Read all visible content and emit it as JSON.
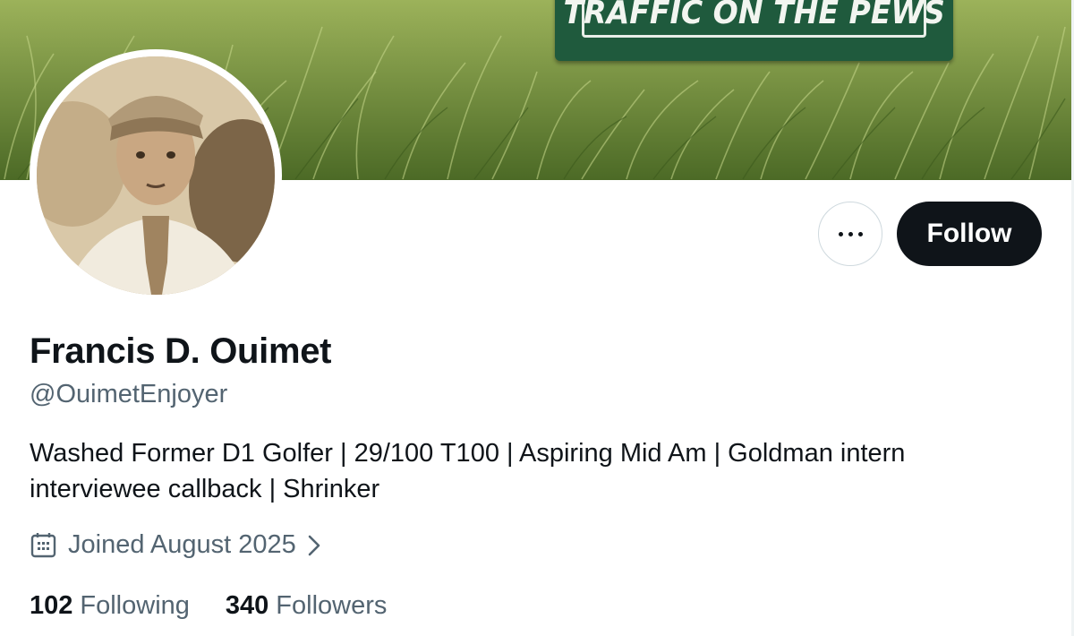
{
  "banner": {
    "sign_text": "TRAFFIC ON THE PEWS"
  },
  "actions": {
    "more_icon": "more-horizontal-icon",
    "follow_label": "Follow"
  },
  "profile": {
    "display_name": "Francis D. Ouimet",
    "handle": "@OuimetEnjoyer",
    "bio_line1": "Washed Former D1 Golfer | 29/100 T100 | Aspiring Mid Am | Goldman intern",
    "bio_line2": "interviewee callback | Shrinker",
    "joined": "Joined August 2025"
  },
  "stats": {
    "following_count": "102",
    "following_label": "Following",
    "followers_count": "340",
    "followers_label": "Followers"
  },
  "colors": {
    "text_primary": "#0f1419",
    "text_secondary": "#536471",
    "follow_bg": "#0f1419",
    "sign_green": "#1f5a3d",
    "border": "#cfd9de"
  }
}
